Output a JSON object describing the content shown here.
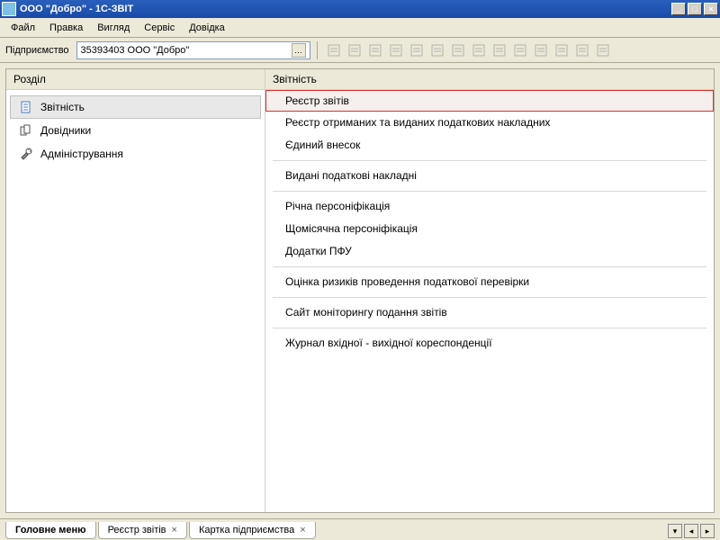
{
  "window": {
    "title": "ООО \"Добро\" - 1С-ЗВІТ"
  },
  "menu": {
    "file": "Файл",
    "edit": "Правка",
    "view": "Вигляд",
    "service": "Сервіс",
    "help": "Довідка"
  },
  "toolbar": {
    "enterprise_label": "Підприємство",
    "enterprise_value": "35393403 ООО \"Добро\""
  },
  "left_panel": {
    "header": "Розділ",
    "items": [
      {
        "label": "Звітність",
        "icon": "document"
      },
      {
        "label": "Довідники",
        "icon": "references"
      },
      {
        "label": "Адміністрування",
        "icon": "tools"
      }
    ],
    "selected_index": 0
  },
  "right_panel": {
    "header": "Звітність",
    "groups": [
      [
        "Реєстр звітів",
        "Реєстр отриманих та виданих податкових накладних",
        "Єдиний внесок"
      ],
      [
        "Видані податкові накладні"
      ],
      [
        "Річна персоніфікація",
        "Щомісячна персоніфікація",
        "Додатки ПФУ"
      ],
      [
        "Оцінка ризиків проведення податкової перевірки"
      ],
      [
        "Сайт моніторингу подання звітів"
      ],
      [
        "Журнал вхідної - вихідної кореспонденції"
      ]
    ],
    "highlighted": "Реєстр звітів"
  },
  "tabs": [
    {
      "label": "Головне меню",
      "closable": false,
      "active": true
    },
    {
      "label": "Реєстр звітів",
      "closable": true,
      "active": false
    },
    {
      "label": "Картка підприємства",
      "closable": true,
      "active": false
    }
  ]
}
